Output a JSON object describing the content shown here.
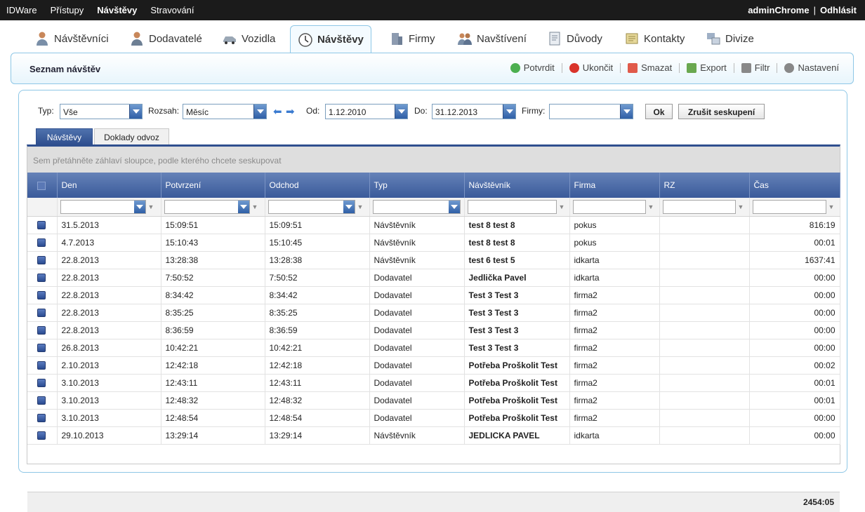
{
  "topbar": {
    "menu": [
      {
        "label": "IDWare",
        "active": false
      },
      {
        "label": "Přístupy",
        "active": false
      },
      {
        "label": "Návštěvy",
        "active": true
      },
      {
        "label": "Stravování",
        "active": false
      }
    ],
    "user": "adminChrome",
    "separator": "|",
    "logout": "Odhlásit"
  },
  "module_tabs": [
    {
      "label": "Návštěvníci",
      "icon": "visitor-person-icon"
    },
    {
      "label": "Dodavatelé",
      "icon": "supplier-person-icon"
    },
    {
      "label": "Vozidla",
      "icon": "car-icon"
    },
    {
      "label": "Návštěvy",
      "icon": "clock-icon",
      "active": true
    },
    {
      "label": "Firmy",
      "icon": "building-icon"
    },
    {
      "label": "Navštívení",
      "icon": "people-icon"
    },
    {
      "label": "Důvody",
      "icon": "document-icon"
    },
    {
      "label": "Kontakty",
      "icon": "address-book-icon"
    },
    {
      "label": "Divize",
      "icon": "division-icon"
    }
  ],
  "header": {
    "title": "Seznam návštěv",
    "actions": [
      {
        "label": "Potvrdit",
        "icon": "check-icon",
        "color": "#4caf50"
      },
      {
        "label": "Ukončit",
        "icon": "stop-icon",
        "color": "#d9342b"
      },
      {
        "label": "Smazat",
        "icon": "delete-icon",
        "color": "#e05a4a"
      },
      {
        "label": "Export",
        "icon": "export-icon",
        "color": "#6aa84f"
      },
      {
        "label": "Filtr",
        "icon": "filter-icon",
        "color": "#888888"
      },
      {
        "label": "Nastavení",
        "icon": "gear-icon",
        "color": "#888888"
      }
    ]
  },
  "filters": {
    "typ_label": "Typ:",
    "typ_value": "Vše",
    "rozsah_label": "Rozsah:",
    "rozsah_value": "Měsíc",
    "od_label": "Od:",
    "od_value": "1.12.2010",
    "do_label": "Do:",
    "do_value": "31.12.2013",
    "firmy_label": "Firmy:",
    "firmy_value": "",
    "ok_label": "Ok",
    "ungroup_label": "Zrušit seskupení"
  },
  "subtabs": [
    {
      "label": "Návštěvy",
      "active": true
    },
    {
      "label": "Doklady odvoz",
      "active": false
    }
  ],
  "grid": {
    "group_hint": "Sem přetáhněte záhlaví sloupce, podle kterého chcete seskupovat",
    "columns": [
      "Den",
      "Potvrzení",
      "Odchod",
      "Typ",
      "Návštěvník",
      "Firma",
      "RZ",
      "Čas"
    ],
    "rows": [
      [
        "31.5.2013",
        "15:09:51",
        "15:09:51",
        "Návštěvník",
        "test 8 test 8",
        "pokus",
        "",
        "816:19"
      ],
      [
        "4.7.2013",
        "15:10:43",
        "15:10:45",
        "Návštěvník",
        "test 8 test 8",
        "pokus",
        "",
        "00:01"
      ],
      [
        "22.8.2013",
        "13:28:38",
        "13:28:38",
        "Návštěvník",
        "test 6 test 5",
        "idkarta",
        "",
        "1637:41"
      ],
      [
        "22.8.2013",
        "7:50:52",
        "7:50:52",
        "Dodavatel",
        "Jedlička Pavel",
        "idkarta",
        "",
        "00:00"
      ],
      [
        "22.8.2013",
        "8:34:42",
        "8:34:42",
        "Dodavatel",
        "Test 3 Test 3",
        "firma2",
        "",
        "00:00"
      ],
      [
        "22.8.2013",
        "8:35:25",
        "8:35:25",
        "Dodavatel",
        "Test 3 Test 3",
        "firma2",
        "",
        "00:00"
      ],
      [
        "22.8.2013",
        "8:36:59",
        "8:36:59",
        "Dodavatel",
        "Test 3 Test 3",
        "firma2",
        "",
        "00:00"
      ],
      [
        "26.8.2013",
        "10:42:21",
        "10:42:21",
        "Dodavatel",
        "Test 3 Test 3",
        "firma2",
        "",
        "00:00"
      ],
      [
        "2.10.2013",
        "12:42:18",
        "12:42:18",
        "Dodavatel",
        "Potřeba Proškolit Test",
        "firma2",
        "",
        "00:02"
      ],
      [
        "3.10.2013",
        "12:43:11",
        "12:43:11",
        "Dodavatel",
        "Potřeba Proškolit Test",
        "firma2",
        "",
        "00:01"
      ],
      [
        "3.10.2013",
        "12:48:32",
        "12:48:32",
        "Dodavatel",
        "Potřeba Proškolit Test",
        "firma2",
        "",
        "00:01"
      ],
      [
        "3.10.2013",
        "12:48:54",
        "12:48:54",
        "Dodavatel",
        "Potřeba Proškolit Test",
        "firma2",
        "",
        "00:00"
      ],
      [
        "29.10.2013",
        "13:29:14",
        "13:29:14",
        "Návštěvník",
        "JEDLICKA PAVEL",
        "idkarta",
        "",
        "00:00"
      ]
    ],
    "total": "2454:05"
  }
}
